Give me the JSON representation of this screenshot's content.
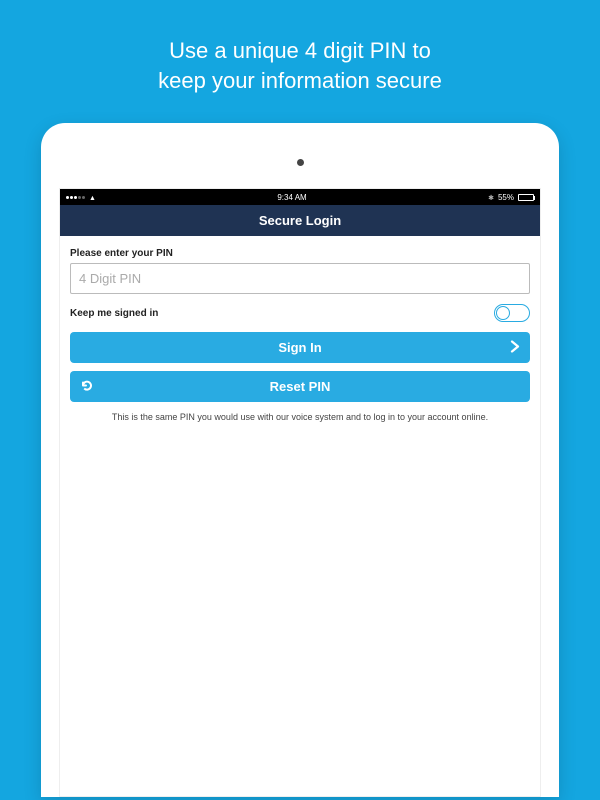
{
  "promo": {
    "line1": "Use a unique 4 digit PIN to",
    "line2": "keep your information secure"
  },
  "status_bar": {
    "carrier_signal": "5-dots",
    "wifi": "wifi",
    "time": "9:34 AM",
    "bluetooth": "bt",
    "battery_pct": "55%"
  },
  "header": {
    "title": "Secure Login"
  },
  "form": {
    "pin_label": "Please enter your PIN",
    "pin_placeholder": "4 Digit PIN",
    "pin_value": "",
    "keep_signed_label": "Keep me signed in",
    "keep_signed_value": false,
    "sign_in_label": "Sign In",
    "reset_pin_label": "Reset PIN",
    "info_text": "This is the same PIN you would use with our voice system and to log in to your account online."
  },
  "colors": {
    "background": "#14a6e0",
    "button": "#29abe2",
    "header_bar": "#1f3353"
  }
}
